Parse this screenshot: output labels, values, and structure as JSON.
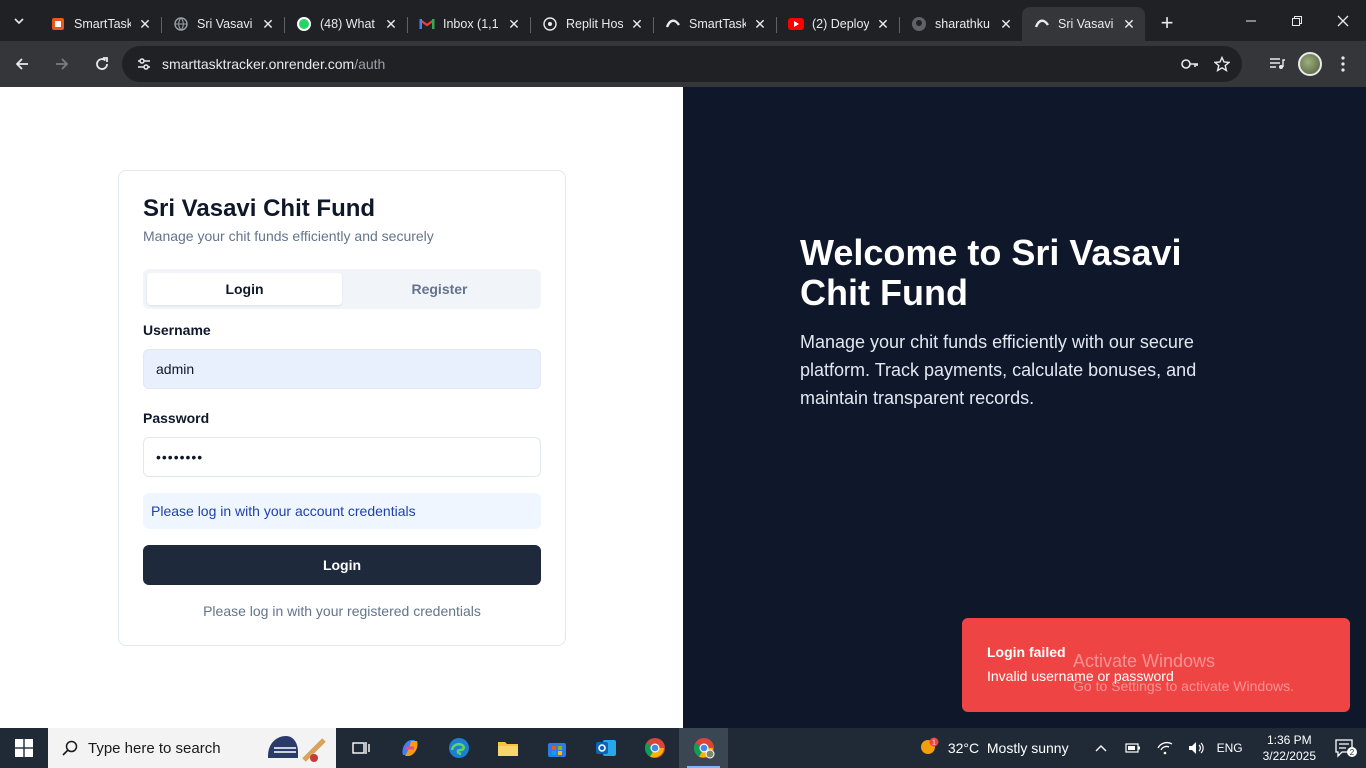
{
  "browser": {
    "tabs": [
      {
        "title": "SmartTask",
        "icon": "render-icon"
      },
      {
        "title": "Sri Vasavi",
        "icon": "globe-icon"
      },
      {
        "title": "(48) What",
        "icon": "whatsapp-icon"
      },
      {
        "title": "Inbox (1,1",
        "icon": "gmail-icon"
      },
      {
        "title": "Replit Hos",
        "icon": "replit-icon"
      },
      {
        "title": "SmartTask",
        "icon": "render-icon"
      },
      {
        "title": "(2) Deploy",
        "icon": "youtube-icon"
      },
      {
        "title": "sharathku",
        "icon": "github-icon"
      },
      {
        "title": "Sri Vasavi",
        "icon": "render-icon",
        "active": true
      }
    ],
    "url_domain": "smarttasktracker.onrender.com",
    "url_path": "/auth"
  },
  "auth_card": {
    "title": "Sri Vasavi Chit Fund",
    "subtitle": "Manage your chit funds efficiently and securely",
    "tab_login": "Login",
    "tab_register": "Register",
    "username_label": "Username",
    "username_value": "admin",
    "password_label": "Password",
    "password_value": "••••••••",
    "info_message": "Please log in with your account credentials",
    "login_button": "Login",
    "footer": "Please log in with your registered credentials"
  },
  "hero": {
    "title": "Welcome to Sri Vasavi Chit Fund",
    "text": "Manage your chit funds efficiently with our secure platform. Track payments, calculate bonuses, and maintain transparent records."
  },
  "toast": {
    "title": "Login failed",
    "description": "Invalid username or password",
    "color": "#ef4444"
  },
  "watermark": {
    "line1": "Activate Windows",
    "line2": "Go to Settings to activate Windows."
  },
  "taskbar": {
    "search_placeholder": "Type here to search",
    "weather_temp": "32°C",
    "weather_desc": "Mostly sunny",
    "weather_badge": "1",
    "language": "ENG",
    "time": "1:36 PM",
    "date": "3/22/2025",
    "notification_count": "2"
  }
}
